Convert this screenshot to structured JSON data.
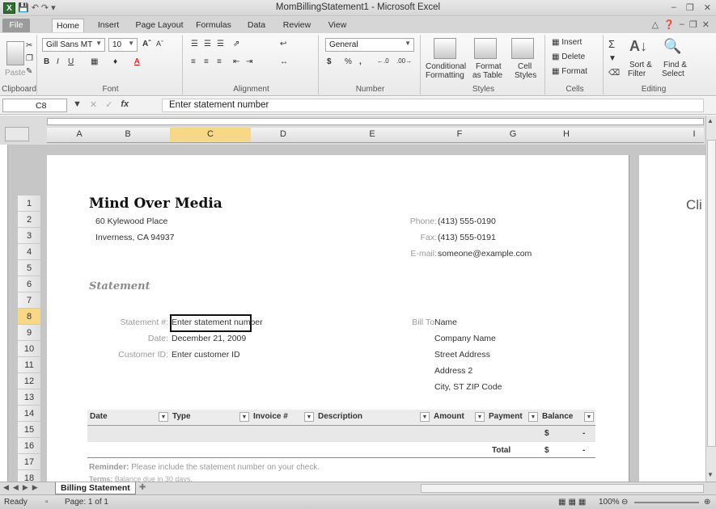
{
  "window": {
    "title": "MomBillingStatement1 - Microsoft Excel"
  },
  "tabs": [
    "File",
    "Home",
    "Insert",
    "Page Layout",
    "Formulas",
    "Data",
    "Review",
    "View"
  ],
  "ribbon": {
    "clipboard": {
      "paste": "Paste",
      "label": "Clipboard"
    },
    "font": {
      "name": "Gill Sans MT",
      "size": "10",
      "label": "Font"
    },
    "alignment": {
      "label": "Alignment"
    },
    "number": {
      "format": "General",
      "label": "Number",
      "currency": "$",
      "percent": "%"
    },
    "styles": {
      "conditional": "Conditional",
      "conditional2": "Formatting",
      "format_table": "Format",
      "format_table2": "as Table",
      "cell_styles": "Cell",
      "cell_styles2": "Styles",
      "label": "Styles"
    },
    "cells": {
      "insert": "Insert",
      "delete": "Delete",
      "format": "Format",
      "label": "Cells"
    },
    "editing": {
      "sort": "Sort &",
      "sort2": "Filter",
      "find": "Find &",
      "find2": "Select",
      "label": "Editing"
    }
  },
  "formula_bar": {
    "name_box": "C8",
    "fx": "fx",
    "formula": "Enter statement number"
  },
  "columns": [
    "A",
    "B",
    "C",
    "D",
    "E",
    "F",
    "G",
    "H",
    "I"
  ],
  "rows": [
    "1",
    "2",
    "3",
    "4",
    "5",
    "6",
    "7",
    "8",
    "9",
    "10",
    "11",
    "12",
    "13",
    "14",
    "15",
    "16",
    "17",
    "18"
  ],
  "sheet": {
    "company": "Mind Over Media",
    "address1": "60 Kylewood Place",
    "address2": "Inverness, CA 94937",
    "phone_label": "Phone:",
    "phone": "(413) 555-0190",
    "fax_label": "Fax:",
    "fax": "(413) 555-0191",
    "email_label": "E-mail:",
    "email": "someone@example.com",
    "heading": "Statement",
    "stmt_label": "Statement #:",
    "stmt_value": "Enter statement number",
    "date_label": "Date:",
    "date_value": "December 21, 2009",
    "cust_label": "Customer ID:",
    "cust_value": "Enter customer ID",
    "billto_label": "Bill To:",
    "billto": [
      "Name",
      "Company Name",
      "Street Address",
      "Address 2",
      "City, ST  ZIP Code"
    ],
    "table_headers": [
      "Date",
      "Type",
      "Invoice #",
      "Description",
      "Amount",
      "Payment",
      "Balance"
    ],
    "row1_balance_symbol": "$",
    "row1_balance_value": "-",
    "total_label": "Total",
    "total_symbol": "$",
    "total_value": "-",
    "reminder_label": "Reminder:",
    "reminder_text": "Please include the statement number on your check.",
    "terms_label": "Terms:",
    "terms_text": "Balance due in 30 days.",
    "next_page_text": "Cli"
  },
  "sheet_tab": "Billing Statement",
  "status": {
    "ready": "Ready",
    "page": "Page: 1 of 1",
    "zoom": "100%"
  }
}
